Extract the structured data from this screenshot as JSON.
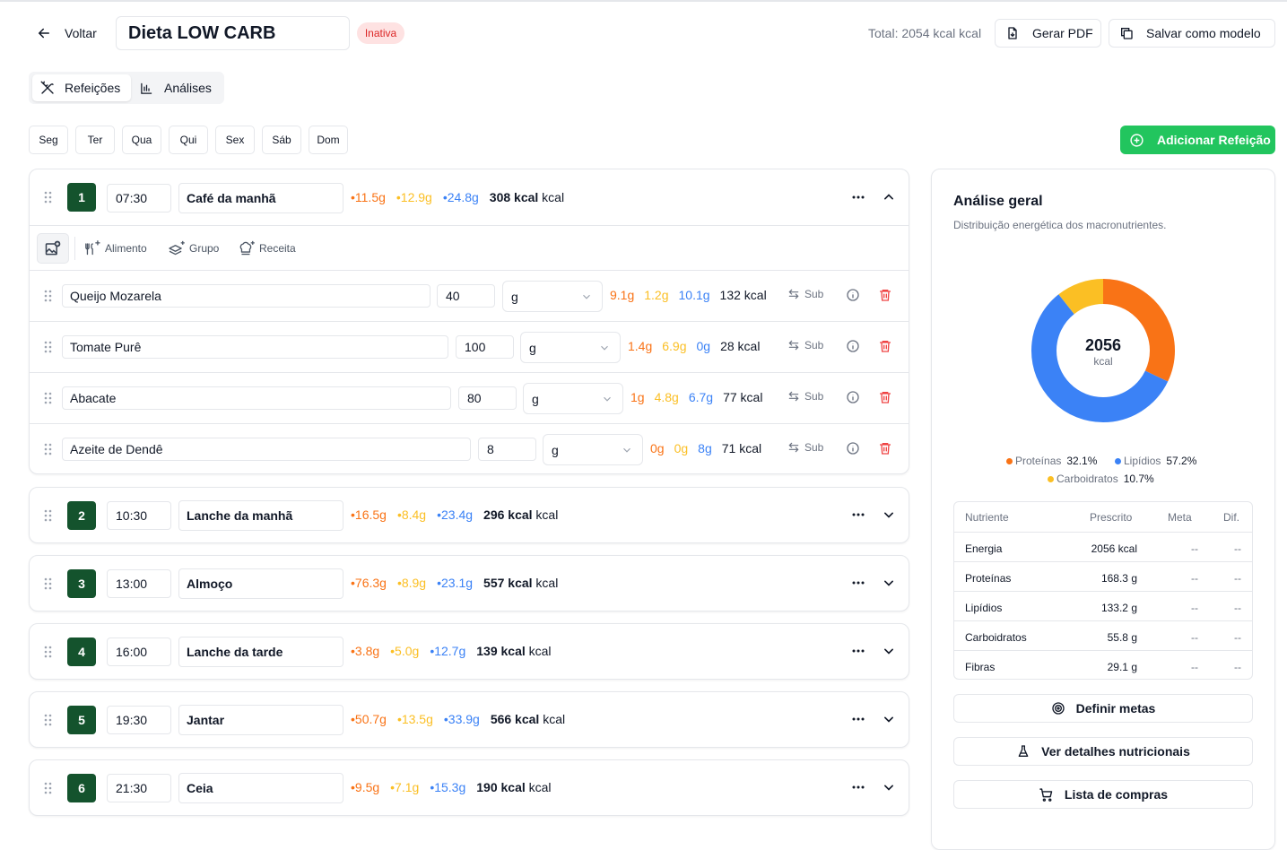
{
  "header": {
    "back_label": "Voltar",
    "diet_name": "Dieta LOW CARB",
    "status_badge": "Inativa",
    "total_label": "Total: 2054 kcal kcal",
    "pdf_button": "Gerar PDF",
    "template_button": "Salvar como modelo"
  },
  "view_tabs": [
    {
      "label": "Refeições",
      "icon": "utensils-icon",
      "active": true
    },
    {
      "label": "Análises",
      "icon": "bar-chart-icon",
      "active": false
    }
  ],
  "days": [
    "Seg",
    "Ter",
    "Qua",
    "Qui",
    "Sex",
    "Sáb",
    "Dom"
  ],
  "add_meal_button": "Adicionar Refeição",
  "add_toolbar": {
    "food": "Alimento",
    "group": "Grupo",
    "recipe": "Receita"
  },
  "sub_label": "Sub",
  "meals": [
    {
      "number": "1",
      "time": "07:30",
      "name": "Café da manhã",
      "protein": "•11.5g",
      "lipid": "•12.9g",
      "carb": "•24.8g",
      "kcal": "308 kcal",
      "kcal_suffix": "kcal",
      "expanded": true,
      "foods": [
        {
          "name": "Queijo Mozarela",
          "qty": "40",
          "unit": "g",
          "p": "9.1g",
          "l": "1.2g",
          "c": "10.1g",
          "kcal": "132 kcal"
        },
        {
          "name": "Tomate Purê",
          "qty": "100",
          "unit": "g",
          "p": "1.4g",
          "l": "6.9g",
          "c": "0g",
          "kcal": "28 kcal"
        },
        {
          "name": "Abacate",
          "qty": "80",
          "unit": "g",
          "p": "1g",
          "l": "4.8g",
          "c": "6.7g",
          "kcal": "77 kcal"
        },
        {
          "name": "Azeite de Dendê",
          "qty": "8",
          "unit": "g",
          "p": "0g",
          "l": "0g",
          "c": "8g",
          "kcal": "71 kcal"
        }
      ]
    },
    {
      "number": "2",
      "time": "10:30",
      "name": "Lanche da manhã",
      "protein": "•16.5g",
      "lipid": "•8.4g",
      "carb": "•23.4g",
      "kcal": "296 kcal",
      "kcal_suffix": "kcal",
      "expanded": false
    },
    {
      "number": "3",
      "time": "13:00",
      "name": "Almoço",
      "protein": "•76.3g",
      "lipid": "•8.9g",
      "carb": "•23.1g",
      "kcal": "557 kcal",
      "kcal_suffix": "kcal",
      "expanded": false
    },
    {
      "number": "4",
      "time": "16:00",
      "name": "Lanche da tarde",
      "protein": "•3.8g",
      "lipid": "•5.0g",
      "carb": "•12.7g",
      "kcal": "139 kcal",
      "kcal_suffix": "kcal",
      "expanded": false
    },
    {
      "number": "5",
      "time": "19:30",
      "name": "Jantar",
      "protein": "•50.7g",
      "lipid": "•13.5g",
      "carb": "•33.9g",
      "kcal": "566 kcal",
      "kcal_suffix": "kcal",
      "expanded": false
    },
    {
      "number": "6",
      "time": "21:30",
      "name": "Ceia",
      "protein": "•9.5g",
      "lipid": "•7.1g",
      "carb": "•15.3g",
      "kcal": "190 kcal",
      "kcal_suffix": "kcal",
      "expanded": false
    }
  ],
  "analysis": {
    "title": "Análise geral",
    "subtitle": "Distribuição energética dos macronutrientes.",
    "donut_value": "2056",
    "donut_unit": "kcal",
    "slices": [
      {
        "name": "Proteínas",
        "percent": 32.1,
        "label": "32.1%",
        "color": "#f97316"
      },
      {
        "name": "Lipídios",
        "percent": 57.2,
        "label": "57.2%",
        "color": "#3b82f6"
      },
      {
        "name": "Carboidratos",
        "percent": 10.7,
        "label": "10.7%",
        "color": "#fbbf24"
      }
    ],
    "table_headers": [
      "Nutriente",
      "Prescrito",
      "Meta",
      "Dif."
    ],
    "table_rows": [
      {
        "name": "Energia",
        "prescribed": "2056 kcal",
        "goal": "--",
        "diff": "--"
      },
      {
        "name": "Proteínas",
        "prescribed": "168.3 g",
        "goal": "--",
        "diff": "--"
      },
      {
        "name": "Lipídios",
        "prescribed": "133.2 g",
        "goal": "--",
        "diff": "--"
      },
      {
        "name": "Carboidratos",
        "prescribed": "55.8 g",
        "goal": "--",
        "diff": "--"
      },
      {
        "name": "Fibras",
        "prescribed": "29.1 g",
        "goal": "--",
        "diff": "--"
      }
    ],
    "actions": [
      {
        "label": "Definir metas",
        "icon": "target-icon"
      },
      {
        "label": "Ver detalhes nutricionais",
        "icon": "flask-icon"
      },
      {
        "label": "Lista de compras",
        "icon": "cart-icon"
      }
    ]
  },
  "colors": {
    "protein": "#f97316",
    "lipid": "#fbbf24",
    "carb": "#3b82f6",
    "accent": "#22c55e",
    "meal_badge": "#14532d",
    "danger": "#ef4444"
  }
}
